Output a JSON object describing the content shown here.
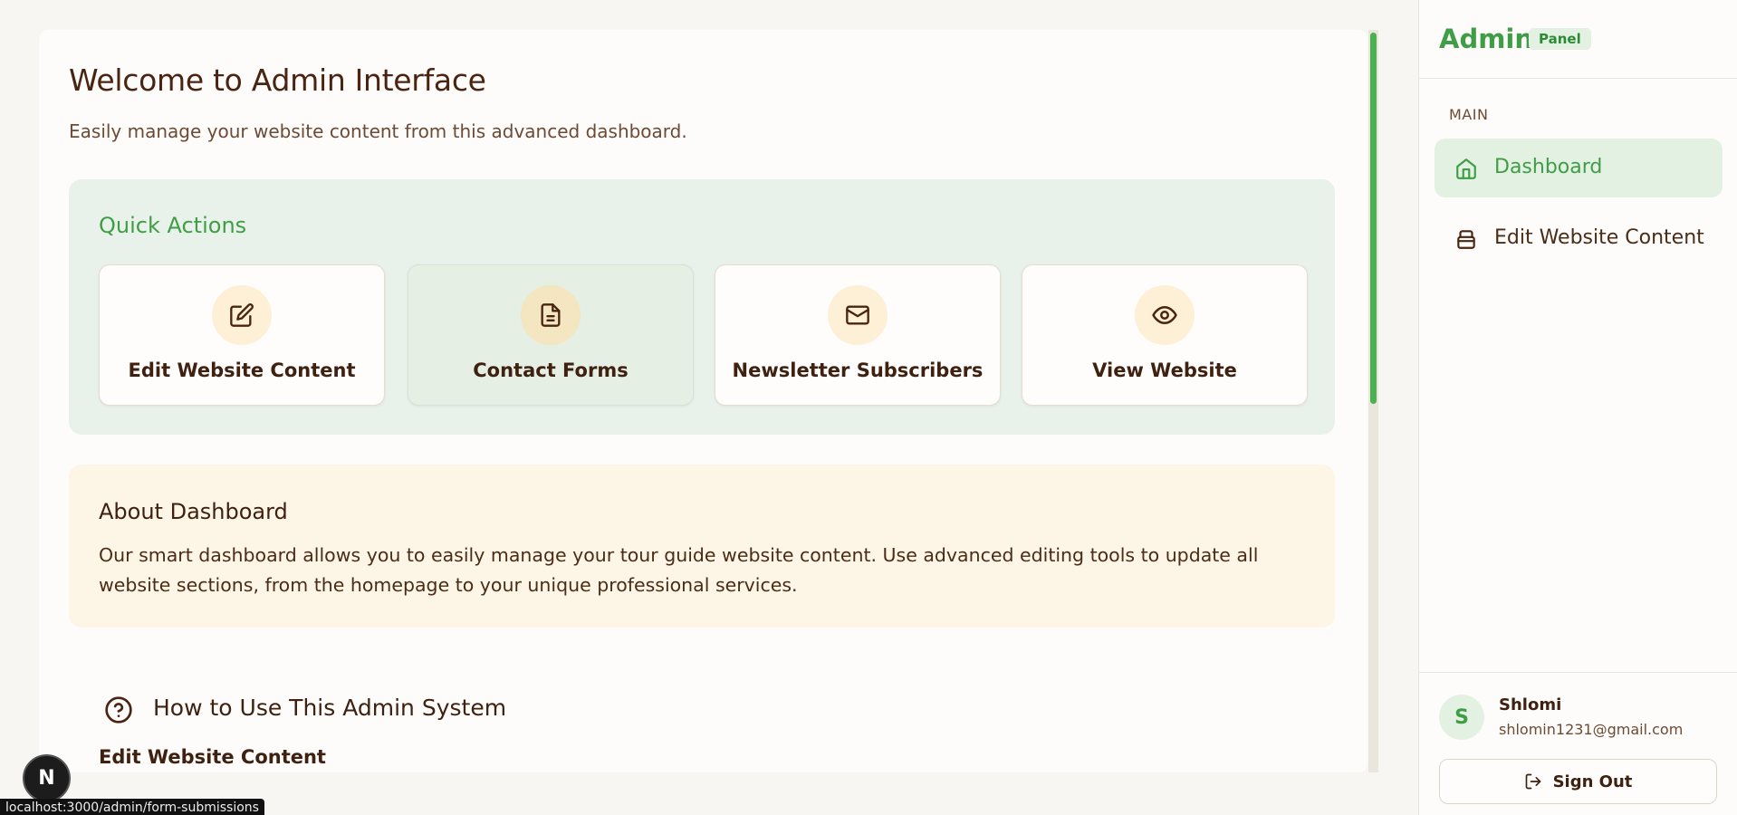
{
  "main": {
    "title": "Welcome to Admin Interface",
    "subtitle": "Easily manage your website content from this advanced dashboard.",
    "quick_actions": {
      "title": "Quick Actions",
      "items": [
        {
          "label": "Edit Website Content",
          "icon": "edit-icon"
        },
        {
          "label": "Contact Forms",
          "icon": "file-text-icon"
        },
        {
          "label": "Newsletter Subscribers",
          "icon": "mail-icon"
        },
        {
          "label": "View Website",
          "icon": "eye-icon"
        }
      ]
    },
    "about": {
      "title": "About Dashboard",
      "text": "Our smart dashboard allows you to easily manage your tour guide website content. Use advanced editing tools to update all website sections, from the homepage to your unique professional services."
    },
    "howto": {
      "title": "How to Use This Admin System",
      "first_section": "Edit Website Content"
    }
  },
  "sidebar": {
    "brand": "Admin",
    "badge": "Panel",
    "section_label": "MAIN",
    "items": [
      {
        "label": "Dashboard",
        "icon": "home-icon",
        "active": true
      },
      {
        "label": "Edit Website Content",
        "icon": "database-icon",
        "active": false
      }
    ],
    "user": {
      "initial": "S",
      "name": "Shlomi",
      "email": "shlomin1231@gmail.com"
    },
    "sign_out_label": "Sign Out"
  },
  "overlay": {
    "dev_badge": "N",
    "status_url": "localhost:3000/admin/form-submissions"
  },
  "colors": {
    "accent": "#3f9e45",
    "brown": "#4a2411",
    "quick_actions_bg": "#e8f2ea",
    "about_bg": "#fdf5e6"
  }
}
